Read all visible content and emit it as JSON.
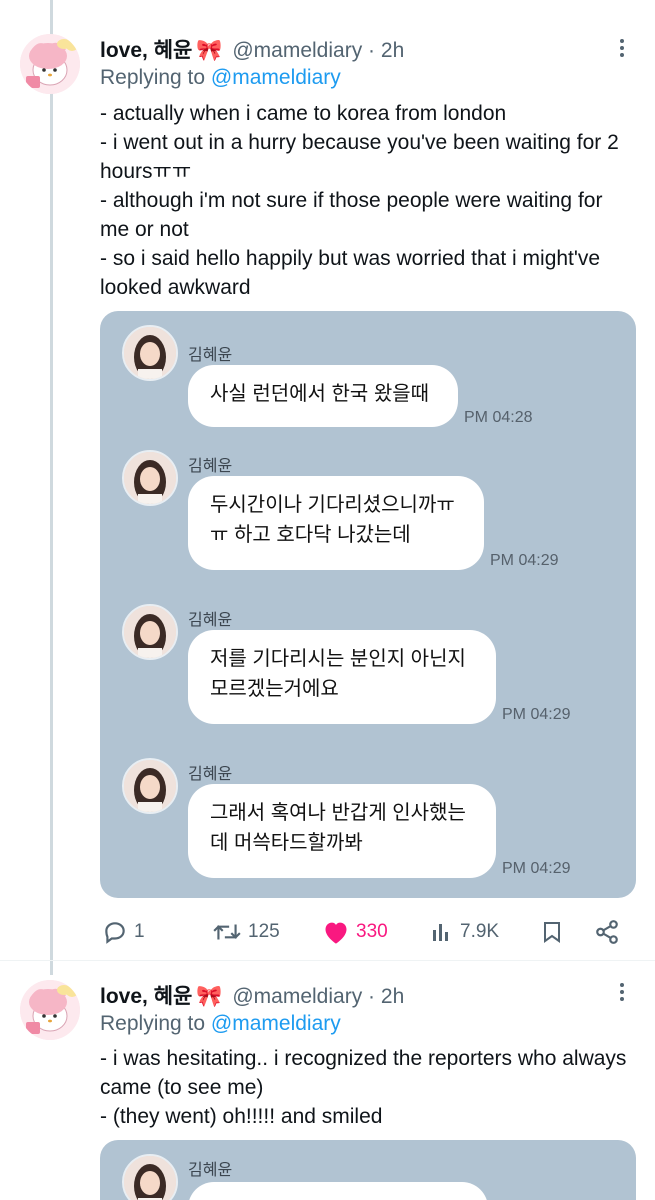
{
  "tweets": [
    {
      "display_name": "love, 혜윤",
      "emoji": "🎀",
      "handle": "@mameldiary",
      "dot": "·",
      "time": "2h",
      "reply_prefix": "Replying to",
      "reply_handle": "@mameldiary",
      "lines": [
        "- actually when i came to korea from london",
        "- i went out in a hurry because you've been waiting for 2 hoursㅠㅠ",
        "- although i'm not sure if those people were waiting for me or not",
        "- so i said hello happily but was worried that i might've looked awkward"
      ],
      "messages": [
        {
          "name": "김혜윤",
          "text": "사실 런던에서 한국 왔을때",
          "time": "PM 04:28"
        },
        {
          "name": "김혜윤",
          "text": "두시간이나 기다리셨으니까ㅠ ㅠ 하고 호다닥 나갔는데",
          "time": "PM 04:29"
        },
        {
          "name": "김혜윤",
          "text": "저를 기다리시는 분인지 아닌지 모르겠는거에요",
          "time": "PM 04:29"
        },
        {
          "name": "김혜윤",
          "text": "그래서 혹여나 반갑게 인사했는 데 머쓱타드할까봐",
          "time": "PM 04:29"
        }
      ],
      "actions": {
        "replies": "1",
        "retweets": "125",
        "likes": "330",
        "views": "7.9K"
      }
    },
    {
      "display_name": "love, 혜윤",
      "emoji": "🎀",
      "handle": "@mameldiary",
      "dot": "·",
      "time": "2h",
      "reply_prefix": "Replying to",
      "reply_handle": "@mameldiary",
      "lines": [
        "- i was hesitating.. i recognized the reporters who always came (to see me)",
        "- (they went) oh!!!!! and smiled"
      ],
      "messages": [
        {
          "name": "김혜윤"
        }
      ]
    }
  ],
  "colors": {
    "accent": "#1d9bf0",
    "like": "#f91880",
    "chat_background": "#b1c3d2",
    "secondary_text": "#536471"
  },
  "icons": [
    "my-melody-avatar",
    "more-icon",
    "reply-icon",
    "retweet-icon",
    "heart-icon",
    "views-icon",
    "bookmark-icon",
    "share-icon"
  ]
}
